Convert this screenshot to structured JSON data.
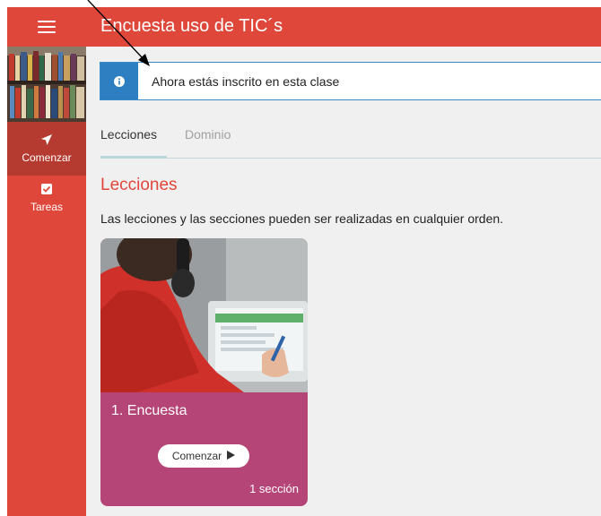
{
  "app": {
    "title": "Encuesta uso de TIC´s"
  },
  "sidebar": {
    "menu_icon": "hamburger-icon",
    "items": [
      {
        "label": "Comenzar",
        "icon": "send-arrow-icon",
        "active": true
      },
      {
        "label": "Tareas",
        "icon": "checklist-icon",
        "active": false
      }
    ]
  },
  "alert": {
    "icon": "info-icon",
    "text": "Ahora estás inscrito en esta clase",
    "color": "#2d7fc1"
  },
  "tabs": [
    {
      "label": "Lecciones",
      "active": true
    },
    {
      "label": "Dominio",
      "active": false
    }
  ],
  "section": {
    "title": "Lecciones",
    "description": "Las lecciones y las secciones pueden ser realizadas en cualquier orden."
  },
  "lessons": [
    {
      "title": "1. Encuesta",
      "button_label": "Comenzar",
      "button_icon": "play-triangle-icon",
      "sections_label": "1 sección"
    }
  ],
  "colors": {
    "brand_red": "#e0473b",
    "active_nav": "#b53a30",
    "card": "#b64577",
    "content_bg": "#f0f0f0"
  }
}
